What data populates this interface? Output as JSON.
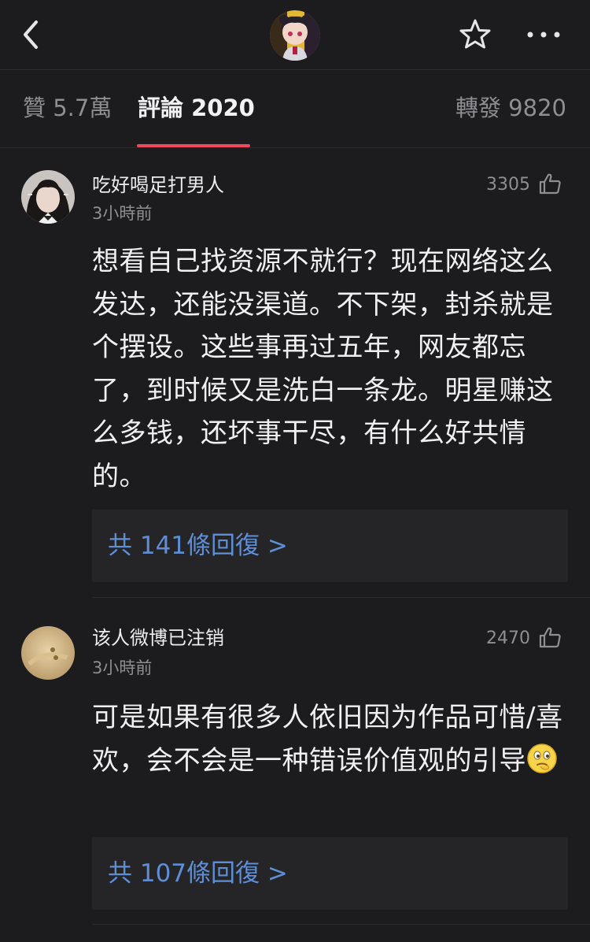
{
  "header": {
    "back_icon": "chevron-left-icon",
    "avatar_icon": "anime-girl-avatar",
    "favorite_icon": "star-icon",
    "more_icon": "more-dots-icon"
  },
  "tabs": {
    "likes": "贊 5.7萬",
    "comments": "評論 2020",
    "reposts": "轉發 9820",
    "active_color": "#ec4a5e"
  },
  "comments": [
    {
      "username": "吃好喝足打男人",
      "time": "3小時前",
      "likes": "3305",
      "text": "想看自己找资源不就行？现在网络这么发达，还能没渠道。不下架，封杀就是个摆设。这些事再过五年，网友都忘了，到时候又是洗白一条龙。明星赚这么多钱，还坏事干尽，有什么好共情的。",
      "replies": "共 141條回復 >"
    },
    {
      "username": "该人微博已注销",
      "time": "3小時前",
      "likes": "2470",
      "text": "可是如果有很多人依旧因为作品可惜/喜欢，会不会是一种错误价值观的引导",
      "emoji": "thinking-face-emoji",
      "replies": "共 107條回復 >"
    }
  ],
  "colors": {
    "background": "#1c1c1e",
    "reply_link": "#5e8fd6"
  }
}
